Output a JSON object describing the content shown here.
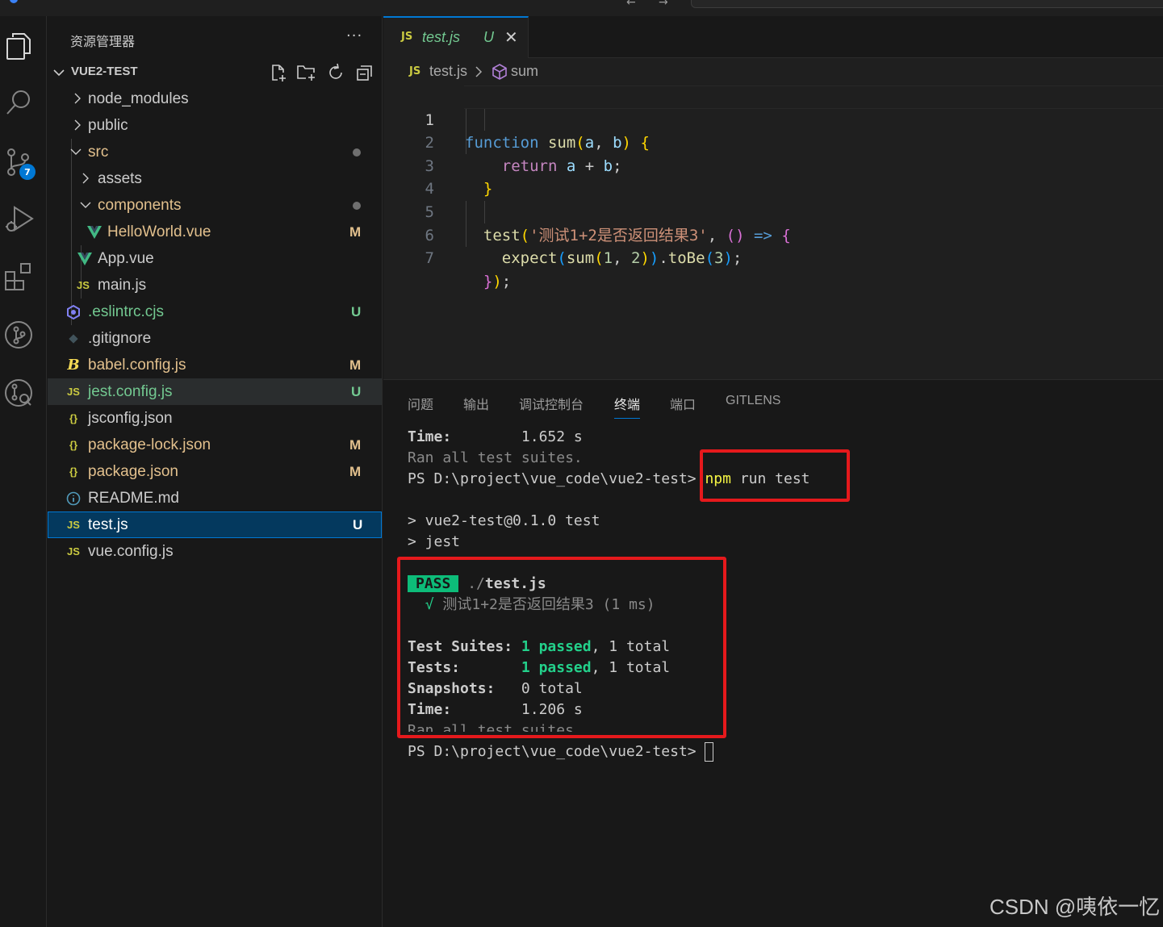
{
  "sidebar": {
    "title": "资源管理器",
    "more": "···",
    "workspace": "VUE2-TEST",
    "tree": [
      {
        "label": "node_modules",
        "status": ""
      },
      {
        "label": "public",
        "status": ""
      },
      {
        "label": "src",
        "status": ""
      },
      {
        "label": "assets",
        "status": ""
      },
      {
        "label": "components",
        "status": ""
      },
      {
        "label": "HelloWorld.vue",
        "status": "M"
      },
      {
        "label": "App.vue",
        "status": ""
      },
      {
        "label": "main.js",
        "status": ""
      },
      {
        "label": ".eslintrc.cjs",
        "status": "U"
      },
      {
        "label": ".gitignore",
        "status": ""
      },
      {
        "label": "babel.config.js",
        "status": "M"
      },
      {
        "label": "jest.config.js",
        "status": "U"
      },
      {
        "label": "jsconfig.json",
        "status": ""
      },
      {
        "label": "package-lock.json",
        "status": "M"
      },
      {
        "label": "package.json",
        "status": "M"
      },
      {
        "label": "README.md",
        "status": ""
      },
      {
        "label": "test.js",
        "status": "U"
      },
      {
        "label": "vue.config.js",
        "status": ""
      }
    ]
  },
  "activity": {
    "scm_badge": "7"
  },
  "editor": {
    "tab": {
      "icon": "JS",
      "name": "test.js",
      "status": "U",
      "close": "✕"
    },
    "breadcrumb": {
      "icon": "JS",
      "file": "test.js",
      "symbol": "sum"
    },
    "line_numbers": [
      "1",
      "2",
      "3",
      "4",
      "5",
      "6",
      "7"
    ],
    "test_name": "'测试1+2是否返回结果3'"
  },
  "panel": {
    "tabs": [
      "问题",
      "输出",
      "调试控制台",
      "终端",
      "端口",
      "GITLENS"
    ],
    "active_tab": "终端"
  },
  "terminal": {
    "time_label_1": "Time:",
    "time_value_1": "1.652 s",
    "ran_all_1": "Ran all test suites.",
    "prompt_1": "PS D:\\project\\vue_code\\vue2-test> ",
    "cmd_npm": "npm",
    "cmd_rest": " run test",
    "script_line": "> vue2-test@0.1.0 test",
    "jest_line": "> jest",
    "pass_badge": "PASS",
    "pass_dir": "./",
    "pass_file": "test.js",
    "check_mark": "√",
    "test_case": " 测试1+2是否返回结果3 (1 ms)",
    "suites_label": "Test Suites:",
    "suites_passed": "1 passed",
    "suites_total": "1 total",
    "tests_label": "Tests:",
    "tests_passed": "1 passed",
    "tests_total": "1 total",
    "snapshots_label": "Snapshots:",
    "snapshots_value": "0 total",
    "time_label_2": "Time:",
    "time_value_2": "1.206 s",
    "ran_all_2": "Ran all test suites.",
    "prompt_2": "PS D:\\project\\vue_code\\vue2-test> "
  },
  "watermark": "CSDN @咦依一忆",
  "colors": {
    "accent": "#0078d4",
    "modified": "#e2c08d",
    "untracked": "#73c991",
    "highlight_box": "#e5191c",
    "pass_green": "#0dbc79"
  }
}
